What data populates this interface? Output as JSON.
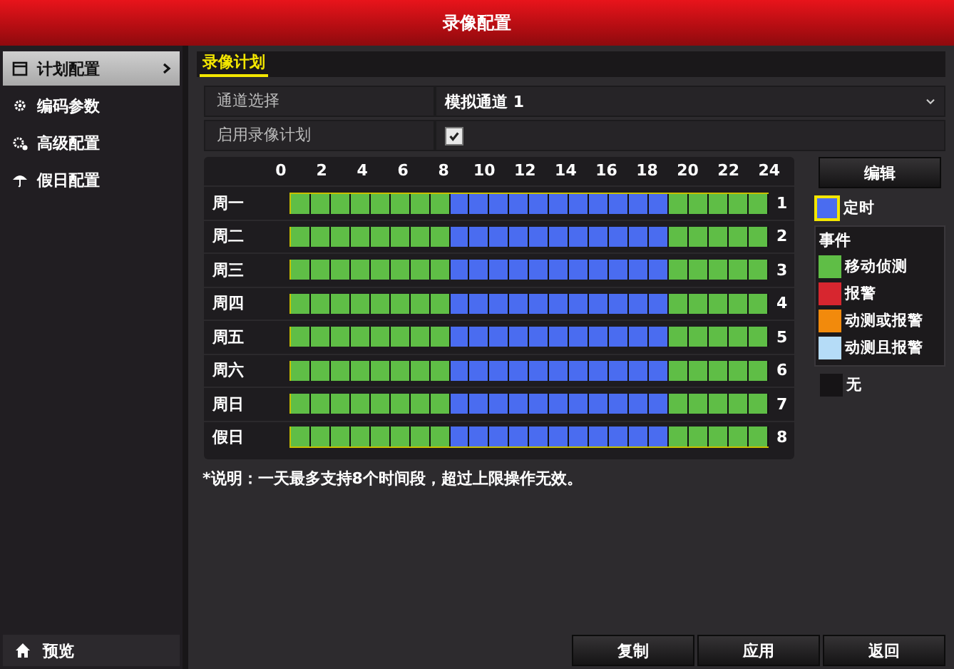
{
  "window": {
    "title": "录像配置"
  },
  "sidebar": {
    "items": [
      {
        "label": "计划配置",
        "selected": true
      },
      {
        "label": "编码参数",
        "selected": false
      },
      {
        "label": "高级配置",
        "selected": false
      },
      {
        "label": "假日配置",
        "selected": false
      }
    ],
    "footer": {
      "label": "预览"
    }
  },
  "tabs": [
    {
      "label": "录像计划",
      "selected": true
    }
  ],
  "form": {
    "channel": {
      "label": "通道选择",
      "value": "模拟通道 1"
    },
    "enable": {
      "label": "启用录像计划",
      "checked": true
    }
  },
  "schedule": {
    "hours": [
      "0",
      "2",
      "4",
      "6",
      "8",
      "10",
      "12",
      "14",
      "16",
      "18",
      "20",
      "22",
      "24"
    ],
    "rows": [
      {
        "label": "周一",
        "number": "1",
        "slots": [
          {
            "kind": "motion"
          },
          {
            "kind": "motion"
          },
          {
            "kind": "motion"
          },
          {
            "kind": "motion"
          },
          {
            "kind": "motion"
          },
          {
            "kind": "motion"
          },
          {
            "kind": "motion"
          },
          {
            "kind": "motion"
          },
          {
            "kind": "timing"
          },
          {
            "kind": "timing"
          },
          {
            "kind": "timing"
          },
          {
            "kind": "timing"
          },
          {
            "kind": "timing"
          },
          {
            "kind": "timing"
          },
          {
            "kind": "timing"
          },
          {
            "kind": "timing"
          },
          {
            "kind": "timing"
          },
          {
            "kind": "timing"
          },
          {
            "kind": "timing"
          },
          {
            "kind": "motion"
          },
          {
            "kind": "motion"
          },
          {
            "kind": "motion"
          },
          {
            "kind": "motion"
          },
          {
            "kind": "motion"
          }
        ]
      },
      {
        "label": "周二",
        "number": "2",
        "slots": [
          {
            "kind": "motion"
          },
          {
            "kind": "motion"
          },
          {
            "kind": "motion"
          },
          {
            "kind": "motion"
          },
          {
            "kind": "motion"
          },
          {
            "kind": "motion"
          },
          {
            "kind": "motion"
          },
          {
            "kind": "motion"
          },
          {
            "kind": "timing"
          },
          {
            "kind": "timing"
          },
          {
            "kind": "timing"
          },
          {
            "kind": "timing"
          },
          {
            "kind": "timing"
          },
          {
            "kind": "timing"
          },
          {
            "kind": "timing"
          },
          {
            "kind": "timing"
          },
          {
            "kind": "timing"
          },
          {
            "kind": "timing"
          },
          {
            "kind": "timing"
          },
          {
            "kind": "motion"
          },
          {
            "kind": "motion"
          },
          {
            "kind": "motion"
          },
          {
            "kind": "motion"
          },
          {
            "kind": "motion"
          }
        ]
      },
      {
        "label": "周三",
        "number": "3",
        "slots": [
          {
            "kind": "motion"
          },
          {
            "kind": "motion"
          },
          {
            "kind": "motion"
          },
          {
            "kind": "motion"
          },
          {
            "kind": "motion"
          },
          {
            "kind": "motion"
          },
          {
            "kind": "motion"
          },
          {
            "kind": "motion"
          },
          {
            "kind": "timing"
          },
          {
            "kind": "timing"
          },
          {
            "kind": "timing"
          },
          {
            "kind": "timing"
          },
          {
            "kind": "timing"
          },
          {
            "kind": "timing"
          },
          {
            "kind": "timing"
          },
          {
            "kind": "timing"
          },
          {
            "kind": "timing"
          },
          {
            "kind": "timing"
          },
          {
            "kind": "timing"
          },
          {
            "kind": "motion"
          },
          {
            "kind": "motion"
          },
          {
            "kind": "motion"
          },
          {
            "kind": "motion"
          },
          {
            "kind": "motion"
          }
        ]
      },
      {
        "label": "周四",
        "number": "4",
        "slots": [
          {
            "kind": "motion"
          },
          {
            "kind": "motion"
          },
          {
            "kind": "motion"
          },
          {
            "kind": "motion"
          },
          {
            "kind": "motion"
          },
          {
            "kind": "motion"
          },
          {
            "kind": "motion"
          },
          {
            "kind": "motion"
          },
          {
            "kind": "timing"
          },
          {
            "kind": "timing"
          },
          {
            "kind": "timing"
          },
          {
            "kind": "timing"
          },
          {
            "kind": "timing"
          },
          {
            "kind": "timing"
          },
          {
            "kind": "timing"
          },
          {
            "kind": "timing"
          },
          {
            "kind": "timing"
          },
          {
            "kind": "timing"
          },
          {
            "kind": "timing"
          },
          {
            "kind": "motion"
          },
          {
            "kind": "motion"
          },
          {
            "kind": "motion"
          },
          {
            "kind": "motion"
          },
          {
            "kind": "motion"
          }
        ]
      },
      {
        "label": "周五",
        "number": "5",
        "slots": [
          {
            "kind": "motion"
          },
          {
            "kind": "motion"
          },
          {
            "kind": "motion"
          },
          {
            "kind": "motion"
          },
          {
            "kind": "motion"
          },
          {
            "kind": "motion"
          },
          {
            "kind": "motion"
          },
          {
            "kind": "motion"
          },
          {
            "kind": "timing"
          },
          {
            "kind": "timing"
          },
          {
            "kind": "timing"
          },
          {
            "kind": "timing"
          },
          {
            "kind": "timing"
          },
          {
            "kind": "timing"
          },
          {
            "kind": "timing"
          },
          {
            "kind": "timing"
          },
          {
            "kind": "timing"
          },
          {
            "kind": "timing"
          },
          {
            "kind": "timing"
          },
          {
            "kind": "motion"
          },
          {
            "kind": "motion"
          },
          {
            "kind": "motion"
          },
          {
            "kind": "motion"
          },
          {
            "kind": "motion"
          }
        ]
      },
      {
        "label": "周六",
        "number": "6",
        "slots": [
          {
            "kind": "motion"
          },
          {
            "kind": "motion"
          },
          {
            "kind": "motion"
          },
          {
            "kind": "motion"
          },
          {
            "kind": "motion"
          },
          {
            "kind": "motion"
          },
          {
            "kind": "motion"
          },
          {
            "kind": "motion"
          },
          {
            "kind": "timing"
          },
          {
            "kind": "timing"
          },
          {
            "kind": "timing"
          },
          {
            "kind": "timing"
          },
          {
            "kind": "timing"
          },
          {
            "kind": "timing"
          },
          {
            "kind": "timing"
          },
          {
            "kind": "timing"
          },
          {
            "kind": "timing"
          },
          {
            "kind": "timing"
          },
          {
            "kind": "timing"
          },
          {
            "kind": "motion"
          },
          {
            "kind": "motion"
          },
          {
            "kind": "motion"
          },
          {
            "kind": "motion"
          },
          {
            "kind": "motion"
          }
        ]
      },
      {
        "label": "周日",
        "number": "7",
        "slots": [
          {
            "kind": "motion"
          },
          {
            "kind": "motion"
          },
          {
            "kind": "motion"
          },
          {
            "kind": "motion"
          },
          {
            "kind": "motion"
          },
          {
            "kind": "motion"
          },
          {
            "kind": "motion"
          },
          {
            "kind": "motion"
          },
          {
            "kind": "timing"
          },
          {
            "kind": "timing"
          },
          {
            "kind": "timing"
          },
          {
            "kind": "timing"
          },
          {
            "kind": "timing"
          },
          {
            "kind": "timing"
          },
          {
            "kind": "timing"
          },
          {
            "kind": "timing"
          },
          {
            "kind": "timing"
          },
          {
            "kind": "timing"
          },
          {
            "kind": "timing"
          },
          {
            "kind": "motion"
          },
          {
            "kind": "motion"
          },
          {
            "kind": "motion"
          },
          {
            "kind": "motion"
          },
          {
            "kind": "motion"
          }
        ]
      },
      {
        "label": "假日",
        "number": "8",
        "slots": [
          {
            "kind": "motion"
          },
          {
            "kind": "motion"
          },
          {
            "kind": "motion"
          },
          {
            "kind": "motion"
          },
          {
            "kind": "motion"
          },
          {
            "kind": "motion"
          },
          {
            "kind": "motion"
          },
          {
            "kind": "motion"
          },
          {
            "kind": "timing"
          },
          {
            "kind": "timing"
          },
          {
            "kind": "timing"
          },
          {
            "kind": "timing"
          },
          {
            "kind": "timing"
          },
          {
            "kind": "timing"
          },
          {
            "kind": "timing"
          },
          {
            "kind": "timing"
          },
          {
            "kind": "timing"
          },
          {
            "kind": "timing"
          },
          {
            "kind": "timing"
          },
          {
            "kind": "motion"
          },
          {
            "kind": "motion"
          },
          {
            "kind": "motion"
          },
          {
            "kind": "motion"
          },
          {
            "kind": "motion"
          }
        ]
      }
    ]
  },
  "legend": {
    "edit_button": "编辑",
    "modes": [
      {
        "label": "定时",
        "color": "#4a6cf0",
        "selected": true
      }
    ],
    "events": {
      "title": "事件",
      "items": [
        {
          "label": "移动侦测",
          "color": "#5fbe46",
          "selected": false
        },
        {
          "label": "报警",
          "color": "#d7262f",
          "selected": false
        },
        {
          "label": "动测或报警",
          "color": "#f28a0c",
          "selected": false
        },
        {
          "label": "动测且报警",
          "color": "#b5dcf7",
          "selected": false
        }
      ]
    },
    "none": {
      "label": "无",
      "selected": false
    }
  },
  "note": "*说明：一天最多支持8个时间段，超过上限操作无效。",
  "buttons": [
    "复制",
    "应用",
    "返回"
  ]
}
